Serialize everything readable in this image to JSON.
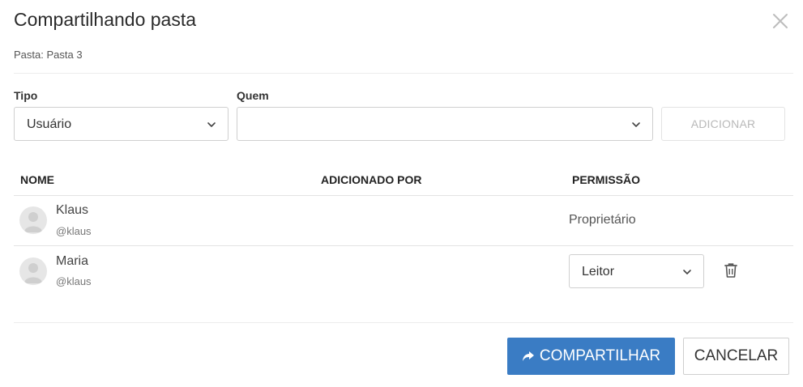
{
  "dialog": {
    "title": "Compartilhando pasta",
    "subtitle": "Pasta: Pasta 3"
  },
  "form": {
    "tipo_label": "Tipo",
    "tipo_value": "Usuário",
    "quem_label": "Quem",
    "quem_value": "",
    "add_label": "ADICIONAR"
  },
  "table": {
    "headers": [
      "NOME",
      "ADICIONADO POR",
      "PERMISSÃO"
    ],
    "rows": [
      {
        "name": "Klaus",
        "handle": "@klaus",
        "added_by": "",
        "permission": "Proprietário"
      },
      {
        "name": "Maria",
        "handle": "@klaus",
        "added_by": "",
        "permission": "Leitor"
      }
    ]
  },
  "footer": {
    "share_label": "COMPARTILHAR",
    "cancel_label": "CANCELAR"
  },
  "colors": {
    "primary": "#3a7cc4",
    "disabled_text": "#b9b9b9"
  },
  "icons": {
    "close": "close-icon",
    "chevron": "chevron-down-icon",
    "avatar": "user-icon",
    "trash": "trash-icon",
    "share": "share-arrow-icon"
  }
}
